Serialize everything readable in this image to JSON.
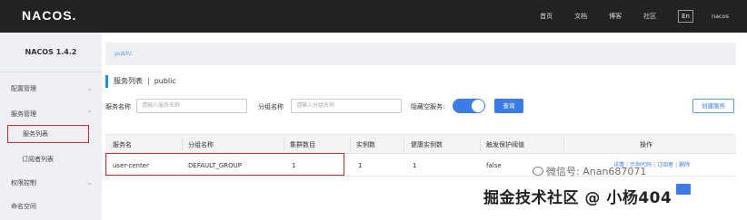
{
  "topbar": {
    "logo": "NACOS.",
    "nav": [
      "首页",
      "文档",
      "博客",
      "社区"
    ],
    "lang": "En",
    "user": "nacos"
  },
  "sidebar": {
    "version": "NACOS 1.4.2",
    "items": [
      {
        "label": "配置管理",
        "chevron": "⌄"
      },
      {
        "label": "服务管理",
        "chevron": "⌃"
      },
      {
        "label": "服务列表"
      },
      {
        "label": "订阅者列表"
      },
      {
        "label": "权限控制",
        "chevron": "⌄"
      },
      {
        "label": "命名空间"
      }
    ]
  },
  "main": {
    "breadcrumb": "public",
    "title": "服务列表",
    "title_sep": "|",
    "namespace": "public",
    "filters": {
      "service_name_label": "服务名称",
      "service_name_placeholder": "请输入服务名称",
      "group_name_label": "分组名称",
      "group_name_placeholder": "请输入分组名称",
      "hide_empty_label": "隐藏空服务:",
      "hide_empty_on": true,
      "query_label": "查询",
      "create_label": "创建服务"
    },
    "table": {
      "columns": [
        "服务名",
        "分组名称",
        "集群数目",
        "实例数",
        "健康实例数",
        "触发保护阈值",
        "操作"
      ],
      "rows": [
        {
          "service": "user-center",
          "group": "DEFAULT_GROUP",
          "clusters": "1",
          "instances": "1",
          "healthy": "1",
          "threshold": "false",
          "actions": [
            "详情",
            "示例代码",
            "订阅者",
            "删除"
          ]
        }
      ]
    }
  },
  "watermark": {
    "wechat": "微信号: Anan687071",
    "juejin": "掘金技术社区 @ 小杨404"
  },
  "colors": {
    "accent": "#3b7de8",
    "highlight_border": "#e0262c",
    "topbar": "#222222",
    "sidebar": "#eef0f3"
  }
}
